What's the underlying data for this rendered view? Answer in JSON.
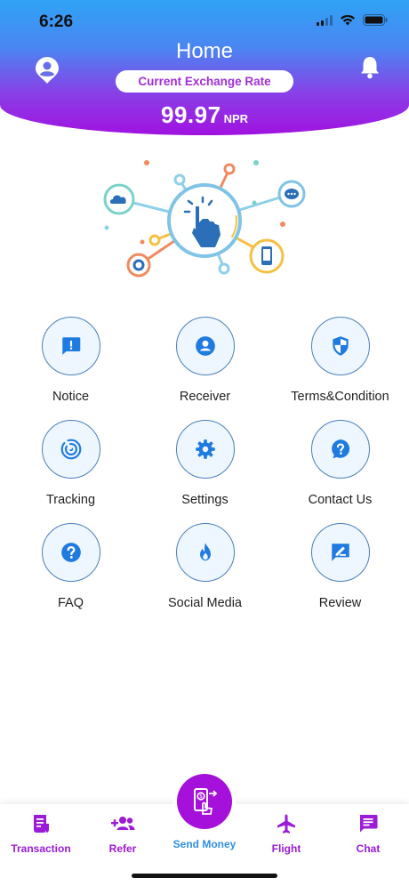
{
  "status_bar": {
    "time": "6:26"
  },
  "header": {
    "title": "Home",
    "exchange_label": "Current Exchange Rate",
    "rate_value": "99.97",
    "rate_unit": "NPR"
  },
  "menu": [
    {
      "label": "Notice",
      "icon": "notice-icon"
    },
    {
      "label": "Receiver",
      "icon": "receiver-icon"
    },
    {
      "label": "Terms&Condition",
      "icon": "shield-icon"
    },
    {
      "label": "Tracking",
      "icon": "tracking-icon"
    },
    {
      "label": "Settings",
      "icon": "gear-icon"
    },
    {
      "label": "Contact Us",
      "icon": "help-chat-icon"
    },
    {
      "label": "FAQ",
      "icon": "question-icon"
    },
    {
      "label": "Social Media",
      "icon": "flame-icon"
    },
    {
      "label": "Review",
      "icon": "review-icon"
    }
  ],
  "bottom_nav": [
    {
      "label": "Transaction",
      "icon": "receipt-icon"
    },
    {
      "label": "Refer",
      "icon": "add-group-icon"
    },
    {
      "label": "Send Money",
      "icon": "send-money-icon"
    },
    {
      "label": "Flight",
      "icon": "airplane-icon"
    },
    {
      "label": "Chat",
      "icon": "chat-icon"
    }
  ],
  "colors": {
    "header_gradient_top": "#2fa3f5",
    "header_gradient_bottom": "#a012e0",
    "accent_purple": "#a510db",
    "icon_blue": "#1f7be0",
    "send_money_label": "#2f8fe0"
  }
}
